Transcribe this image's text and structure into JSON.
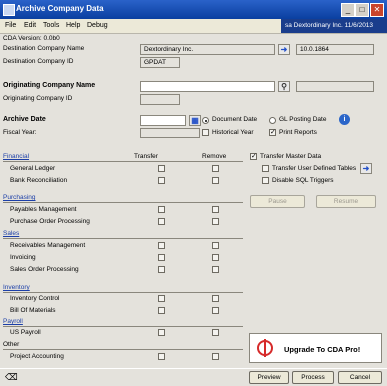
{
  "window": {
    "title": "Archive Company Data",
    "min": "_",
    "max": "□",
    "close": "✕"
  },
  "menu": [
    "File",
    "Edit",
    "Tools",
    "Help",
    "Debug"
  ],
  "user_status": "sa  Dextordinary Inc.  11/6/2013",
  "header": {
    "cda_version": "CDA Version: 0.0b0",
    "dest_company_name_label": "Destination Company Name",
    "dest_company_name_value": "Dextordinary Inc.",
    "dest_company_version": "10.0.1864",
    "dest_company_id_label": "Destination Company ID",
    "dest_company_id_value": "GPDAT"
  },
  "origin": {
    "name_label": "Originating Company Name",
    "name_value": "",
    "id_label": "Originating Company ID",
    "id_value": ""
  },
  "archive": {
    "date_label": "Archive Date",
    "date_value": "",
    "fiscal_label": "Fiscal Year:",
    "radio_document": "Document Date",
    "radio_gl": "GL Posting Date",
    "historical_year": "Historical Year",
    "print_reports": "Print Reports"
  },
  "columns": {
    "transfer": "Transfer",
    "remove": "Remove"
  },
  "options": {
    "transfer_master": "Transfer Master Data",
    "transfer_udt": "Transfer User Defined Tables",
    "disable_sql": "Disable SQL Triggers"
  },
  "sections": {
    "financial": "Financial",
    "general_ledger": "General Ledger",
    "bank_rec": "Bank Reconciliation",
    "purchasing": "Purchasing",
    "payables": "Payables Management",
    "purchase_order": "Purchase Order Processing",
    "sales": "Sales",
    "receivables": "Receivables Management",
    "invoicing": "Invoicing",
    "sales_order": "Sales Order Processing",
    "inventory": "Inventory",
    "inventory_control": "Inventory Control",
    "bill_of_materials": "Bill Of Materials",
    "payroll": "Payroll",
    "us_payroll": "US Payroll",
    "other": "Other",
    "project_accounting": "Project Accounting"
  },
  "buttons": {
    "pause": "Pause",
    "resume": "Resume",
    "upgrade": "Upgrade To CDA Pro!",
    "preview": "Preview",
    "process": "Process",
    "cancel": "Cancel"
  },
  "icons": {
    "lookup": "lookup-icon",
    "calendar": "calendar-icon",
    "info": "info-icon",
    "arrow": "arrow-right-icon",
    "eraser": "eraser-icon"
  }
}
